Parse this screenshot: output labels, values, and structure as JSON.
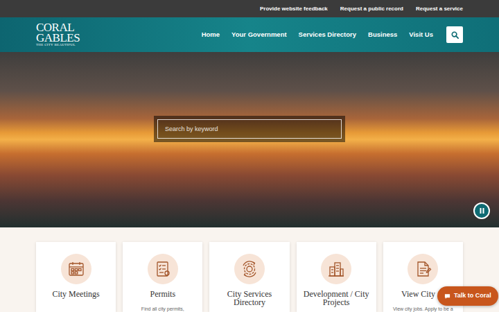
{
  "utility_links": [
    "Provide website feedback",
    "Request a public record",
    "Request a service"
  ],
  "logo": {
    "line1": "CORAL",
    "line2": "GABLES",
    "tagline": "THE CITY BEAUTIFUL"
  },
  "nav": [
    "Home",
    "Your Government",
    "Services Directory",
    "Business",
    "Visit Us"
  ],
  "hero": {
    "search_placeholder": "Search by keyword"
  },
  "cards": [
    {
      "title": "City Meetings"
    },
    {
      "title": "Permits",
      "description": "Find all city permits,"
    },
    {
      "title": "City Services Directory"
    },
    {
      "title": "Development / City Projects"
    },
    {
      "title": "View City Jo",
      "description": "View city jobs. Apply to be a"
    }
  ],
  "chat": {
    "label": "Talk to Coral"
  }
}
